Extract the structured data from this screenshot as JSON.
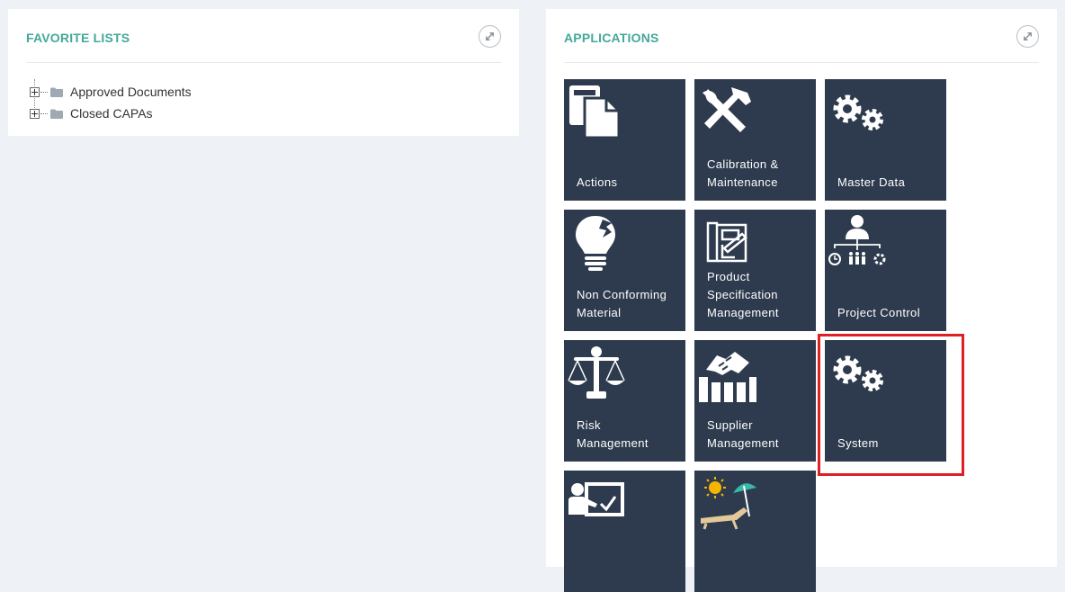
{
  "favorites": {
    "title": "FAVORITE LISTS",
    "items": [
      {
        "label": "Approved Documents",
        "icon": "folder-icon"
      },
      {
        "label": "Closed CAPAs",
        "icon": "folder-icon"
      }
    ]
  },
  "applications": {
    "title": "APPLICATIONS",
    "tiles": [
      {
        "label": "Actions",
        "icon": "document-copy-icon"
      },
      {
        "label": "Calibration &\nMaintenance",
        "icon": "tools-icon"
      },
      {
        "label": "Master Data",
        "icon": "gears-icon"
      },
      {
        "label": "Non Conforming\nMaterial",
        "icon": "broken-bulb-icon"
      },
      {
        "label": "Product\nSpecification\nManagement",
        "icon": "blueprint-icon"
      },
      {
        "label": "Project Control",
        "icon": "org-chart-icon"
      },
      {
        "label": "Risk\nManagement",
        "icon": "scales-icon"
      },
      {
        "label": "Supplier\nManagement",
        "icon": "handshake-chart-icon"
      },
      {
        "label": "System",
        "icon": "gears-icon"
      },
      {
        "label": "",
        "icon": "presenter-board-icon"
      },
      {
        "label": "",
        "icon": "beach-chair-icon"
      }
    ]
  },
  "colors": {
    "accent": "#43a89a",
    "tile_bg": "#2e3b4e",
    "highlight": "#e01e26"
  }
}
